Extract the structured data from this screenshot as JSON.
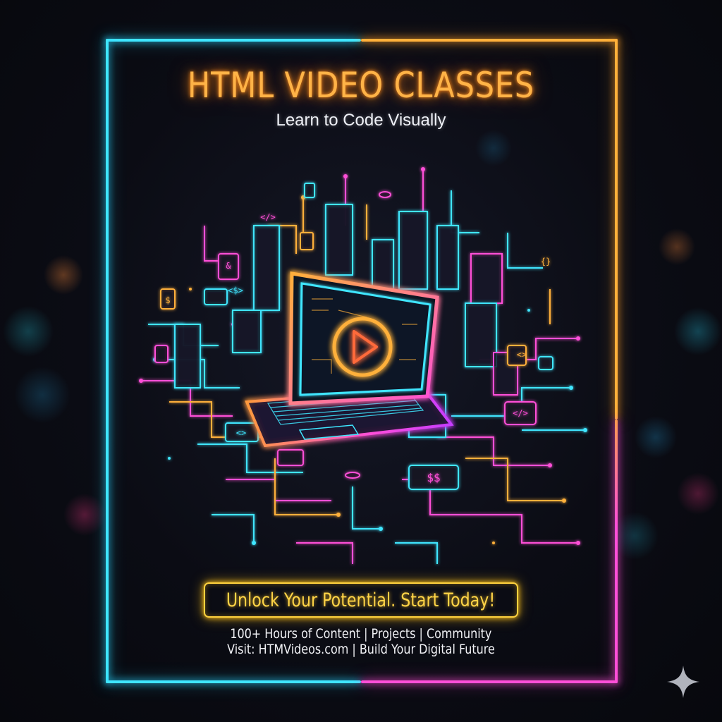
{
  "poster": {
    "title": "HTML VIDEO CLASSES",
    "subtitle": "Learn to Code Visually",
    "cta": "Unlock Your Potential. Start Today!",
    "info_line_1": "100+ Hours of Content | Projects | Community",
    "info_line_2": "Visit: HTMVideos.com | Build Your Digital Future"
  },
  "illustration": {
    "screen_icon": "play-icon",
    "cube_labels": [
      "</>",
      "<$>",
      "{}",
      "<>",
      "$$",
      "&",
      "</>"
    ],
    "center_object": "laptop"
  },
  "colors": {
    "cyan": "#3fe6ff",
    "orange": "#ffb03a",
    "magenta": "#ff4fd8",
    "yellow": "#ffd23f",
    "background": "#07080d"
  },
  "icons": {
    "corner_mark": "sparkle-icon"
  }
}
